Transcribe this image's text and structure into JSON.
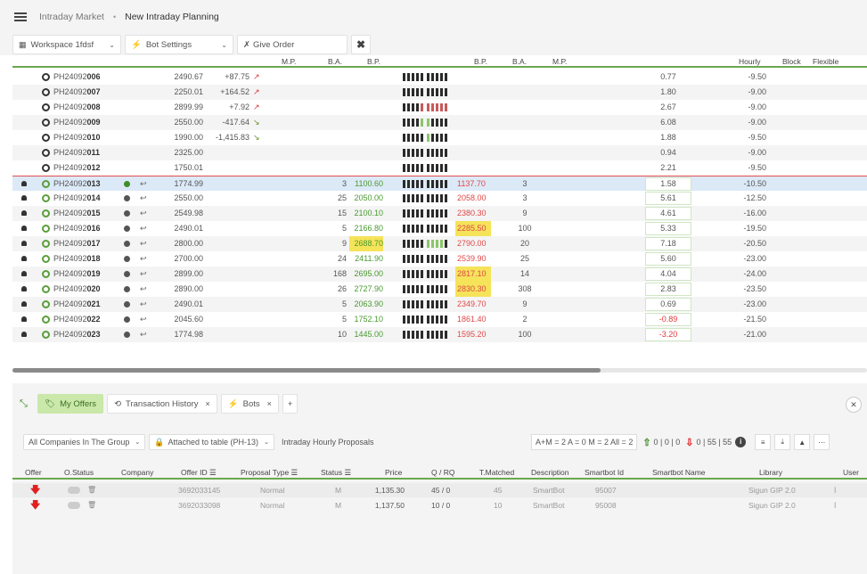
{
  "breadcrumb": {
    "root": "Intraday Market",
    "separator": "•",
    "current": "New Intraday Planning"
  },
  "toolbar": {
    "workspace": "Workspace 1fdsf",
    "bot_settings": "Bot Settings",
    "give_order": "Give Order",
    "clear": "✖"
  },
  "grid": {
    "headers": {
      "mp_left": "M.P.",
      "ba_left": "B.A.",
      "bp_left": "B.P.",
      "bp_right": "B.P.",
      "ba_right": "B.A.",
      "mp_right": "M.P.",
      "hourly": "Hourly",
      "block": "Block",
      "flexible": "Flexible"
    },
    "rows": [
      {
        "prefix": "PH24092",
        "suffix": "006",
        "mp": "2490.67",
        "chg": "+87.75",
        "trend": "up",
        "ba": "",
        "bp": "",
        "sp": "",
        "sba": "",
        "ind": "0.77",
        "hourly": "-9.50"
      },
      {
        "prefix": "PH24092",
        "suffix": "007",
        "mp": "2250.01",
        "chg": "+164.52",
        "trend": "up",
        "ba": "",
        "bp": "",
        "sp": "",
        "sba": "",
        "ind": "1.80",
        "hourly": "-9.00"
      },
      {
        "prefix": "PH24092",
        "suffix": "008",
        "mp": "2899.99",
        "chg": "+7.92",
        "trend": "up",
        "ba": "",
        "bp": "",
        "sp": "",
        "sba": "",
        "ind": "2.67",
        "hourly": "-9.00"
      },
      {
        "prefix": "PH24092",
        "suffix": "009",
        "mp": "2550.00",
        "chg": "-417.64",
        "trend": "down",
        "ba": "",
        "bp": "",
        "sp": "",
        "sba": "",
        "ind": "6.08",
        "hourly": "-9.00"
      },
      {
        "prefix": "PH24092",
        "suffix": "010",
        "mp": "1990.00",
        "chg": "-1,415.83",
        "trend": "down",
        "ba": "",
        "bp": "",
        "sp": "",
        "sba": "",
        "ind": "1.88",
        "hourly": "-9.50"
      },
      {
        "prefix": "PH24092",
        "suffix": "011",
        "mp": "2325.00",
        "chg": "",
        "trend": "",
        "ba": "",
        "bp": "",
        "sp": "",
        "sba": "",
        "ind": "0.94",
        "hourly": "-9.00"
      },
      {
        "prefix": "PH24092",
        "suffix": "012",
        "mp": "1750.01",
        "chg": "",
        "trend": "",
        "ba": "",
        "bp": "",
        "sp": "",
        "sba": "",
        "ind": "2.21",
        "hourly": "-9.50"
      },
      {
        "prefix": "PH24092",
        "suffix": "013",
        "mp": "1774.99",
        "chg": "",
        "trend": "",
        "ba": "3",
        "bp": "1100.60",
        "sp": "1137.70",
        "sba": "3",
        "ind": "1.58",
        "hourly": "-10.50"
      },
      {
        "prefix": "PH24092",
        "suffix": "014",
        "mp": "2550.00",
        "chg": "",
        "trend": "",
        "ba": "25",
        "bp": "2050.00",
        "sp": "2058.00",
        "sba": "3",
        "ind": "5.61",
        "hourly": "-12.50"
      },
      {
        "prefix": "PH24092",
        "suffix": "015",
        "mp": "2549.98",
        "chg": "",
        "trend": "",
        "ba": "15",
        "bp": "2100.10",
        "sp": "2380.30",
        "sba": "9",
        "ind": "4.61",
        "hourly": "-16.00"
      },
      {
        "prefix": "PH24092",
        "suffix": "016",
        "mp": "2490.01",
        "chg": "",
        "trend": "",
        "ba": "5",
        "bp": "2166.80",
        "sp": "2285.50",
        "sba": "100",
        "ind": "5.33",
        "hourly": "-19.50"
      },
      {
        "prefix": "PH24092",
        "suffix": "017",
        "mp": "2800.00",
        "chg": "",
        "trend": "",
        "ba": "9",
        "bp": "2688.70",
        "sp": "2790.00",
        "sba": "20",
        "ind": "7.18",
        "hourly": "-20.50"
      },
      {
        "prefix": "PH24092",
        "suffix": "018",
        "mp": "2700.00",
        "chg": "",
        "trend": "",
        "ba": "24",
        "bp": "2411.90",
        "sp": "2539.90",
        "sba": "25",
        "ind": "5.60",
        "hourly": "-23.00"
      },
      {
        "prefix": "PH24092",
        "suffix": "019",
        "mp": "2899.00",
        "chg": "",
        "trend": "",
        "ba": "168",
        "bp": "2695.00",
        "sp": "2817.10",
        "sba": "14",
        "ind": "4.04",
        "hourly": "-24.00"
      },
      {
        "prefix": "PH24092",
        "suffix": "020",
        "mp": "2890.00",
        "chg": "",
        "trend": "",
        "ba": "26",
        "bp": "2727.90",
        "sp": "2830.30",
        "sba": "308",
        "ind": "2.83",
        "hourly": "-23.50"
      },
      {
        "prefix": "PH24092",
        "suffix": "021",
        "mp": "2490.01",
        "chg": "",
        "trend": "",
        "ba": "5",
        "bp": "2063.90",
        "sp": "2349.70",
        "sba": "9",
        "ind": "0.69",
        "hourly": "-23.00"
      },
      {
        "prefix": "PH24092",
        "suffix": "022",
        "mp": "2045.60",
        "chg": "",
        "trend": "",
        "ba": "5",
        "bp": "1752.10",
        "sp": "1861.40",
        "sba": "2",
        "ind": "-0.89",
        "hourly": "-21.50"
      },
      {
        "prefix": "PH24092",
        "suffix": "023",
        "mp": "1774.98",
        "chg": "",
        "trend": "",
        "ba": "10",
        "bp": "1445.00",
        "sp": "1595.20",
        "sba": "100",
        "ind": "-3.20",
        "hourly": "-21.00"
      }
    ]
  },
  "tabs": [
    {
      "label": "My Offers",
      "close": ""
    },
    {
      "label": "Transaction History",
      "close": "×"
    },
    {
      "label": "Bots",
      "close": "×"
    },
    {
      "label": "+",
      "close": ""
    }
  ],
  "filters": {
    "companies": "All Companies In The Group",
    "attached": "Attached to table (PH-13)",
    "proposals": "Intraday Hourly Proposals"
  },
  "stats": {
    "counts": "A+M = 2   A = 0   M = 2   All = 2",
    "up_counts": "0 | 0 | 0",
    "down_counts": "0 | 55 | 55",
    "info": "i"
  },
  "offers": {
    "headers": {
      "offer": "Offer",
      "ostatus": "O.Status",
      "company": "Company",
      "offer_id": "Offer ID ☰",
      "proposal_type": "Proposal Type ☰",
      "status": "Status ☰",
      "price": "Price",
      "qrq": "Q / RQ",
      "tmatched": "T.Matched",
      "description": "Description",
      "smartbot_id": "Smartbot Id",
      "smartbot_name": "Smartbot Name",
      "library": "Library",
      "user": "User"
    },
    "rows": [
      {
        "id": "3692033145",
        "type": "Normal",
        "status": "M",
        "price": "1,135.30",
        "qrq": "45 / 0",
        "tmatched": "45",
        "desc": "SmartBot",
        "sbid": "95007",
        "lib": "Sigun GIP 2.0",
        "user": "İ"
      },
      {
        "id": "3692033098",
        "type": "Normal",
        "status": "M",
        "price": "1,137.50",
        "qrq": "10 / 0",
        "tmatched": "10",
        "desc": "SmartBot",
        "sbid": "95008",
        "lib": "Sigun GIP 2.0",
        "user": "İ"
      }
    ]
  },
  "colors": {
    "accent": "#6aa84f",
    "buy": "#4a9a30",
    "sell": "#e04848",
    "highlight": "#f5e35a"
  }
}
